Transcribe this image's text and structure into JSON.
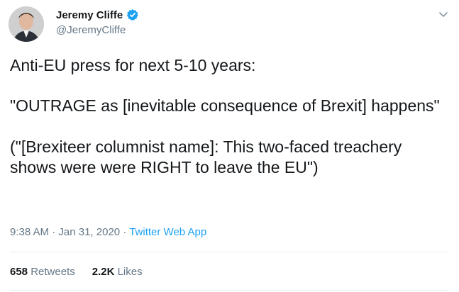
{
  "user": {
    "display_name": "Jeremy Cliffe",
    "handle": "@JeremyCliffe"
  },
  "tweet": {
    "line1": "Anti-EU press for next 5-10 years:",
    "line2": "\"OUTRAGE as [inevitable consequence of Brexit] happens\"",
    "line3": "(\"[Brexiteer columnist name]: This two-faced treachery shows were were RIGHT to leave the EU\")"
  },
  "meta": {
    "time": "9:38 AM",
    "separator": "·",
    "date": "Jan 31, 2020",
    "source": "Twitter Web App"
  },
  "stats": {
    "retweets_count": "658",
    "retweets_label": "Retweets",
    "likes_count": "2.2K",
    "likes_label": "Likes"
  },
  "colors": {
    "text": "#14171a",
    "secondary": "#657786",
    "accent": "#1da1f2",
    "divider": "#e6ecf0"
  },
  "icons": {
    "verified": "verified-badge-icon",
    "more": "chevron-down-icon"
  }
}
